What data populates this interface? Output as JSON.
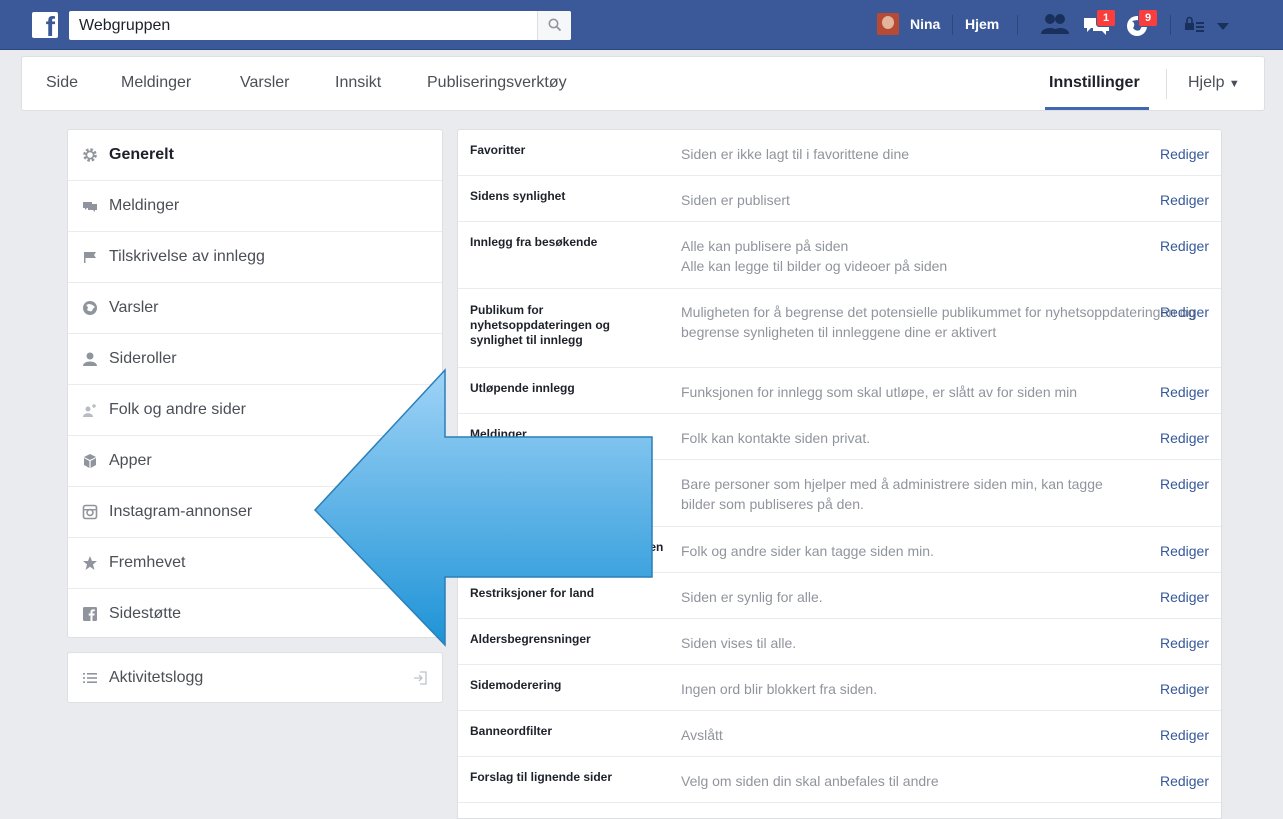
{
  "topbar": {
    "search_value": "Webgruppen",
    "user_name": "Nina",
    "home_label": "Hjem",
    "friend_requests_badge": "",
    "messages_badge": "1",
    "notifications_badge": "9"
  },
  "pagenav": {
    "items": [
      "Side",
      "Meldinger",
      "Varsler",
      "Innsikt",
      "Publiseringsverktøy"
    ],
    "settings_label": "Innstillinger",
    "help_label": "Hjelp"
  },
  "sidebar": {
    "items": [
      {
        "label": "Generelt",
        "icon": "gear-icon"
      },
      {
        "label": "Meldinger",
        "icon": "chat-icon"
      },
      {
        "label": "Tilskrivelse av innlegg",
        "icon": "flag-icon"
      },
      {
        "label": "Varsler",
        "icon": "globe-icon"
      },
      {
        "label": "Sideroller",
        "icon": "person-icon"
      },
      {
        "label": "Folk og andre sider",
        "icon": "person-plus-icon"
      },
      {
        "label": "Apper",
        "icon": "cube-icon"
      },
      {
        "label": "Instagram-annonser",
        "icon": "instagram-icon"
      },
      {
        "label": "Fremhevet",
        "icon": "star-icon"
      },
      {
        "label": "Sidestøtte",
        "icon": "facebook-icon"
      }
    ],
    "activity_log_label": "Aktivitetslogg"
  },
  "settings": {
    "edit_label": "Rediger",
    "rows": [
      {
        "name": "Favoritter",
        "value": "Siden er ikke lagt til i favorittene dine"
      },
      {
        "name": "Sidens synlighet",
        "value": "Siden er publisert"
      },
      {
        "name": "Innlegg fra besøkende",
        "value": "Alle kan publisere på siden",
        "value2": "Alle kan legge til bilder og videoer på siden"
      },
      {
        "name": "Publikum for nyhetsoppdateringen og synlighet til innlegg",
        "value": "Muligheten for å begrense det potensielle publikummet for nyhetsoppdateringen og begrense synligheten til innleggene dine er aktivert"
      },
      {
        "name": "Utløpende innlegg",
        "value": "Funksjonen for innlegg som skal utløpe, er slått av for siden min"
      },
      {
        "name": "Meldinger",
        "value": "Folk kan kontakte siden privat."
      },
      {
        "name": "",
        "value": "Bare personer som hjelper med å administrere siden min, kan tagge bilder som publiseres på den."
      },
      {
        "name": "len",
        "value": "Folk og andre sider kan tagge siden min."
      },
      {
        "name": "Restriksjoner for land",
        "value": "Siden er synlig for alle."
      },
      {
        "name": "Aldersbegrensninger",
        "value": "Siden vises til alle."
      },
      {
        "name": "Sidemoderering",
        "value": "Ingen ord blir blokkert fra siden."
      },
      {
        "name": "Banneordfilter",
        "value": "Avslått"
      },
      {
        "name": "Forslag til lignende sider",
        "value": "Velg om siden din skal anbefales til andre"
      }
    ]
  },
  "colors": {
    "topbar": "#3b5998",
    "link": "#365899",
    "arrow_fill": "#5eb3ea"
  }
}
